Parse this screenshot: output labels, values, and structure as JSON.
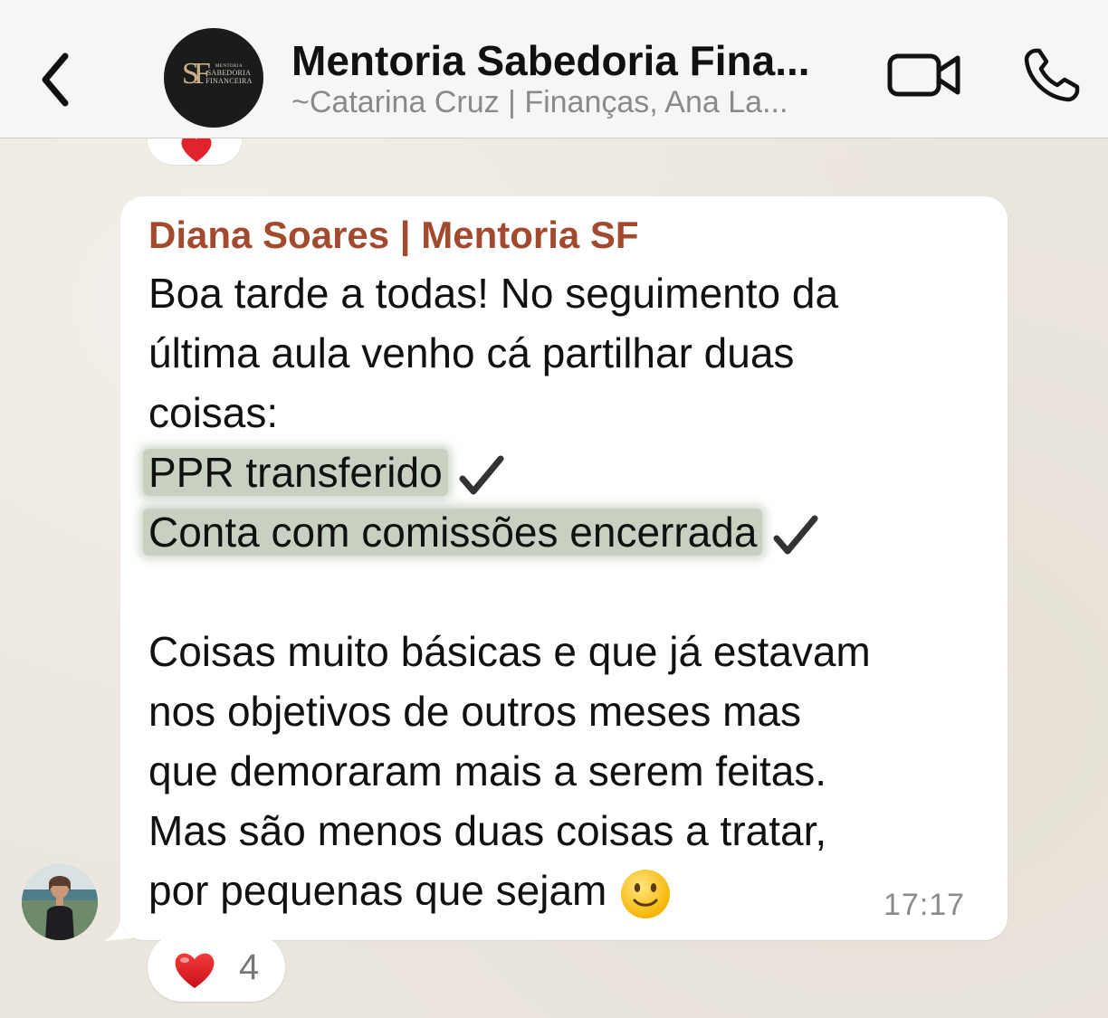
{
  "header": {
    "title": "Mentoria Sabedoria Fina...",
    "subtitle": "~Catarina Cruz | Finanças, Ana La...",
    "group_avatar": {
      "monogram": "SF",
      "small_text": "MENTORIA",
      "line1": "SABEDORIA",
      "line2": "FINANCEIRA"
    },
    "icons": {
      "back": "chevron-left-icon",
      "video": "video-camera-icon",
      "call": "phone-icon"
    }
  },
  "message": {
    "sender": "Diana Soares | Mentoria SF",
    "sender_color": "#a34a2e",
    "lines": [
      "Boa tarde a todas! No seguimento da",
      "última aula venho cá partilhar duas",
      "coisas:"
    ],
    "highlighted_items": [
      "PPR transferido",
      "Conta com comissões encerrada"
    ],
    "body_lines": [
      "Coisas muito básicas e que já estavam",
      "nos objetivos de outros meses mas",
      "que demoraram mais a serem feitas.",
      "Mas são menos duas coisas a tratar,",
      "por pequenas que sejam"
    ],
    "emoji": "slightly-smiling-face",
    "time": "17:17",
    "reaction": {
      "emoji": "red-heart",
      "count": "4"
    }
  },
  "colors": {
    "highlight": "#aab8a0",
    "chat_background": "#ebe6de",
    "bubble": "#ffffff"
  }
}
